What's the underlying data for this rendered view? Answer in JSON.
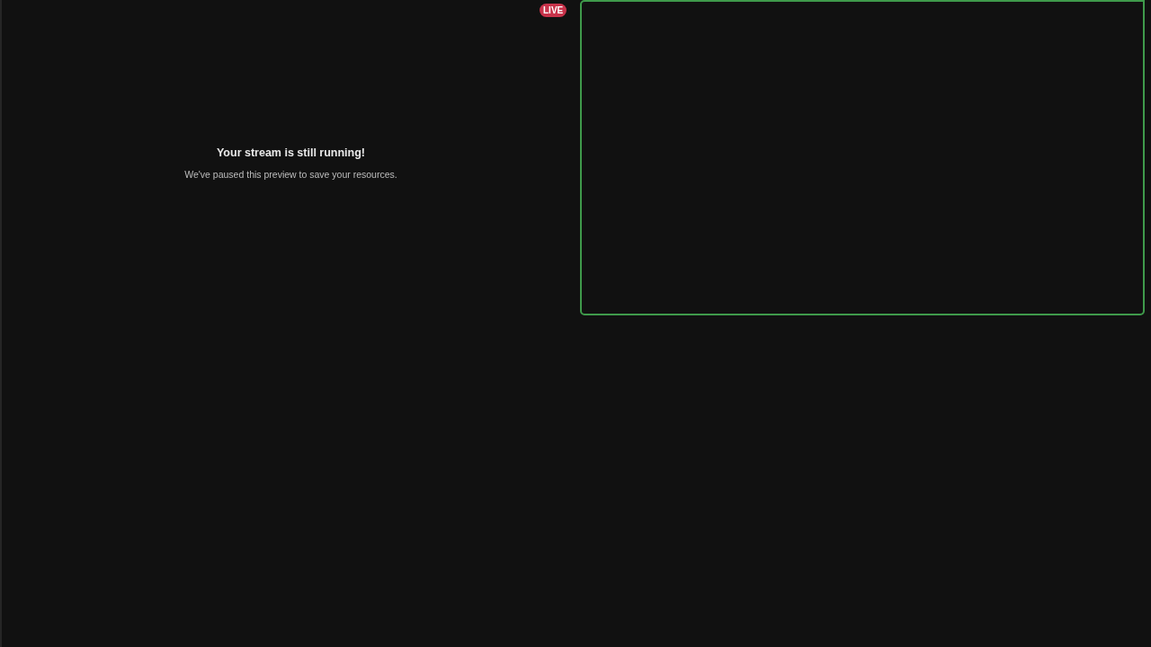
{
  "preview": {
    "badge": "LIVE",
    "title": "Your stream is still running!",
    "message": "We've paused this preview to save your resources."
  },
  "side_panel": {
    "selected": true
  }
}
